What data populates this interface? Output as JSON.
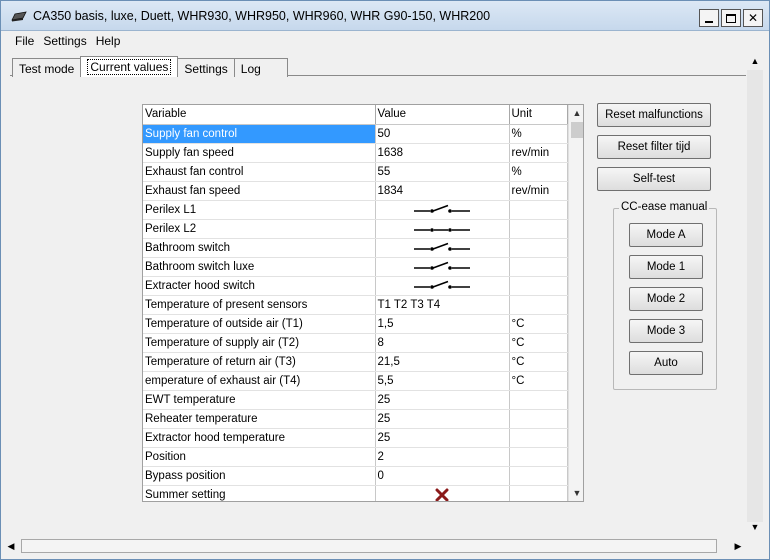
{
  "window": {
    "title": "CA350 basis, luxe, Duett, WHR930, WHR950, WHR960, WHR G90-150, WHR200",
    "controls": {
      "minimize": "minimize",
      "maximize": "maximize",
      "close": "✕"
    }
  },
  "menu": [
    "File",
    "Settings",
    "Help"
  ],
  "tabs": [
    {
      "label": "Test mode",
      "active": false
    },
    {
      "label": "Current values",
      "active": true
    },
    {
      "label": "Settings",
      "active": false
    },
    {
      "label": "Log",
      "active": false
    }
  ],
  "grid": {
    "headers": {
      "variable": "Variable",
      "value": "Value",
      "unit": "Unit"
    },
    "rows": [
      {
        "variable": "Supply fan control",
        "value": "50",
        "unit": "%",
        "selected": true
      },
      {
        "variable": "Supply fan speed",
        "value": "1638",
        "unit": "rev/min"
      },
      {
        "variable": "Exhaust fan control",
        "value": "55",
        "unit": "%"
      },
      {
        "variable": "Exhaust fan speed",
        "value": "1834",
        "unit": "rev/min"
      },
      {
        "variable": "Perilex L1",
        "value_icon": "switch-open-icon",
        "unit": ""
      },
      {
        "variable": "Perilex L2",
        "value_icon": "switch-closed-icon",
        "unit": ""
      },
      {
        "variable": "Bathroom switch",
        "value_icon": "switch-open-icon",
        "unit": ""
      },
      {
        "variable": "Bathroom switch luxe",
        "value_icon": "switch-open-icon",
        "unit": ""
      },
      {
        "variable": "Extracter hood switch",
        "value_icon": "switch-open-icon",
        "unit": ""
      },
      {
        "variable": "Temperature of present sensors",
        "value": "T1 T2 T3 T4",
        "unit": ""
      },
      {
        "variable": "Temperature of outside air (T1)",
        "value": "1,5",
        "unit": "°C"
      },
      {
        "variable": "Temperature of supply air (T2)",
        "value": "8",
        "unit": "°C"
      },
      {
        "variable": "Temperature of return air (T3)",
        "value": "21,5",
        "unit": "°C"
      },
      {
        "variable": "emperature of exhaust air (T4)",
        "value": "5,5",
        "unit": "°C"
      },
      {
        "variable": "EWT temperature",
        "value": "25",
        "unit": ""
      },
      {
        "variable": "Reheater temperature",
        "value": "25",
        "unit": ""
      },
      {
        "variable": "Extractor hood temperature",
        "value": "25",
        "unit": ""
      },
      {
        "variable": "Position",
        "value": "2",
        "unit": ""
      },
      {
        "variable": "Bypass position",
        "value": "0",
        "unit": ""
      },
      {
        "variable": "Summer setting",
        "value_icon": "red-x-icon",
        "unit": ""
      }
    ]
  },
  "buttons": {
    "reset_malfunctions": "Reset malfunctions",
    "reset_filter": "Reset filter tijd",
    "self_test": "Self-test"
  },
  "cc_ease": {
    "label": "CC-ease manual",
    "modes": [
      "Mode A",
      "Mode 1",
      "Mode 2",
      "Mode 3",
      "Auto"
    ]
  },
  "colors": {
    "selection": "#3399ff",
    "red_x": "#8b1a1a"
  }
}
